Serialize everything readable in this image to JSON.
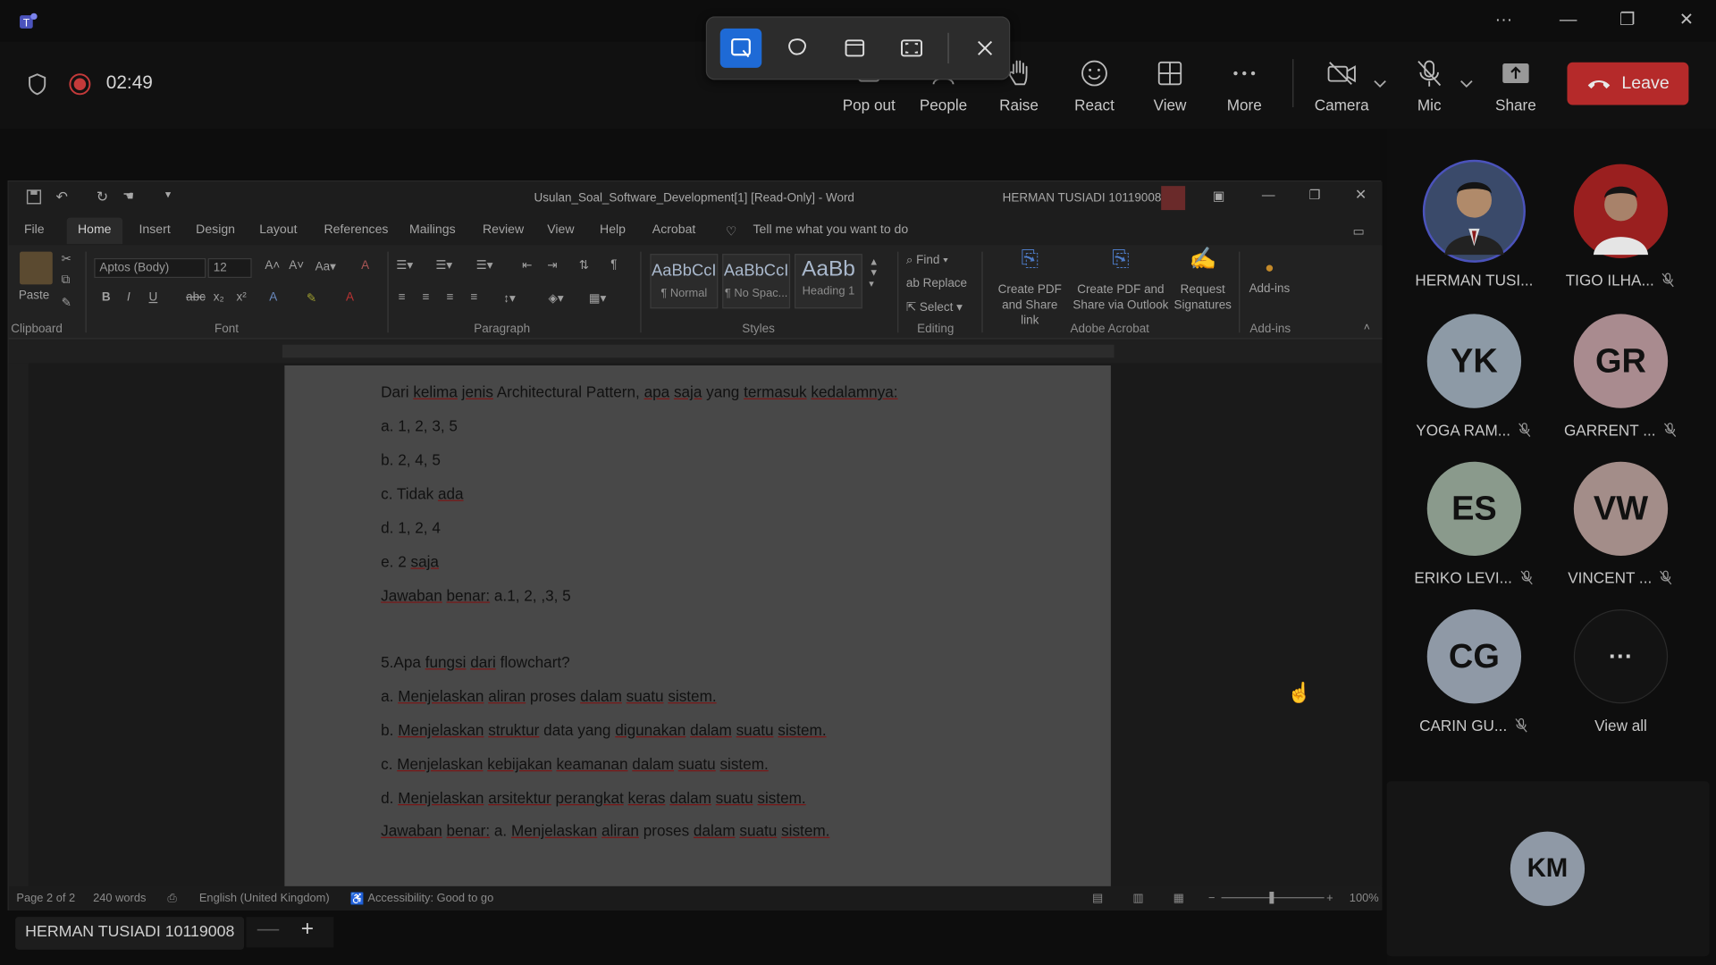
{
  "teams": {
    "timer": "02:49",
    "toolbar": [
      {
        "name": "pop-out",
        "label": "Pop out"
      },
      {
        "name": "people",
        "label": "People"
      },
      {
        "name": "raise",
        "label": "Raise"
      },
      {
        "name": "react",
        "label": "React"
      },
      {
        "name": "view",
        "label": "View"
      },
      {
        "name": "more",
        "label": "More"
      },
      {
        "name": "camera",
        "label": "Camera"
      },
      {
        "name": "mic",
        "label": "Mic"
      },
      {
        "name": "share",
        "label": "Share"
      }
    ],
    "leave_label": "Leave",
    "window_controls": [
      "···",
      "—",
      "❐",
      "✕"
    ],
    "presenter_name": "HERMAN TUSIADI 10119008",
    "zoom_minus": "—",
    "zoom_plus": "+"
  },
  "word": {
    "title": "Usulan_Soal_Software_Development[1] [Read-Only]  -  Word",
    "user": "HERMAN TUSIADI 10119008",
    "menu": [
      "File",
      "Home",
      "Insert",
      "Design",
      "Layout",
      "References",
      "Mailings",
      "Review",
      "View",
      "Help",
      "Acrobat"
    ],
    "tell_me": "Tell me what you want to do",
    "ribbon": {
      "paste": "Paste",
      "clipboard": "Clipboard",
      "font_name": "Aptos (Body)",
      "font_size": "12",
      "font": "Font",
      "paragraph": "Paragraph",
      "styles": [
        {
          "preview": "AaBbCcI",
          "name": "¶ Normal"
        },
        {
          "preview": "AaBbCcI",
          "name": "¶ No Spac..."
        },
        {
          "preview": "AaBb",
          "name": "Heading 1"
        }
      ],
      "styles_label": "Styles",
      "find": "Find",
      "replace": "Replace",
      "select": "Select",
      "editing": "Editing",
      "create_pdf_share": "Create PDF and Share link",
      "create_pdf_outlook": "Create PDF and Share via Outlook",
      "request_signatures": "Request Signatures",
      "adobe_acrobat": "Adobe Acrobat",
      "addins": "Add-ins",
      "addins_group": "Add-ins"
    },
    "document_lines": [
      "Dari kelima jenis Architectural Pattern, apa saja yang termasuk kedalamnya:",
      "a. 1, 2, 3, 5",
      "b. 2, 4, 5",
      "c. Tidak ada",
      "d. 1, 2, 4",
      "e. 2 saja",
      "Jawaban benar: a.1, 2, ,3, 5",
      "",
      "5.Apa fungsi dari flowchart?",
      "a. Menjelaskan aliran proses dalam suatu sistem.",
      "b. Menjelaskan struktur data yang digunakan dalam suatu sistem.",
      "c. Menjelaskan kebijakan keamanan dalam suatu sistem.",
      "d. Menjelaskan arsitektur perangkat keras dalam suatu sistem.",
      "Jawaban benar: a. Menjelaskan aliran proses dalam suatu sistem."
    ],
    "status": {
      "page": "Page 2 of 2",
      "words": "240 words",
      "language": "English (United Kingdom)",
      "accessibility": "Accessibility: Good to go",
      "zoom": "100%"
    }
  },
  "participants": [
    {
      "initials": "",
      "name": "HERMAN TUSI...",
      "muted": false,
      "photo": true,
      "color": "#3a4a6a"
    },
    {
      "initials": "",
      "name": "TIGO ILHA...",
      "muted": true,
      "photo": true,
      "color": "#9a1f1f"
    },
    {
      "initials": "YK",
      "name": "YOGA RAM...",
      "muted": true,
      "photo": false,
      "color": "#8d9aa6"
    },
    {
      "initials": "GR",
      "name": "GARRENT ...",
      "muted": true,
      "photo": false,
      "color": "#a98b8f"
    },
    {
      "initials": "ES",
      "name": "ERIKO LEVI...",
      "muted": true,
      "photo": false,
      "color": "#8a9a8c"
    },
    {
      "initials": "VW",
      "name": "VINCENT ...",
      "muted": true,
      "photo": false,
      "color": "#a38d89"
    },
    {
      "initials": "CG",
      "name": "CARIN GU...",
      "muted": true,
      "photo": false,
      "color": "#8f99a6"
    }
  ],
  "view_all": "View all",
  "view_all_icon": "···",
  "km_initials": "KM"
}
